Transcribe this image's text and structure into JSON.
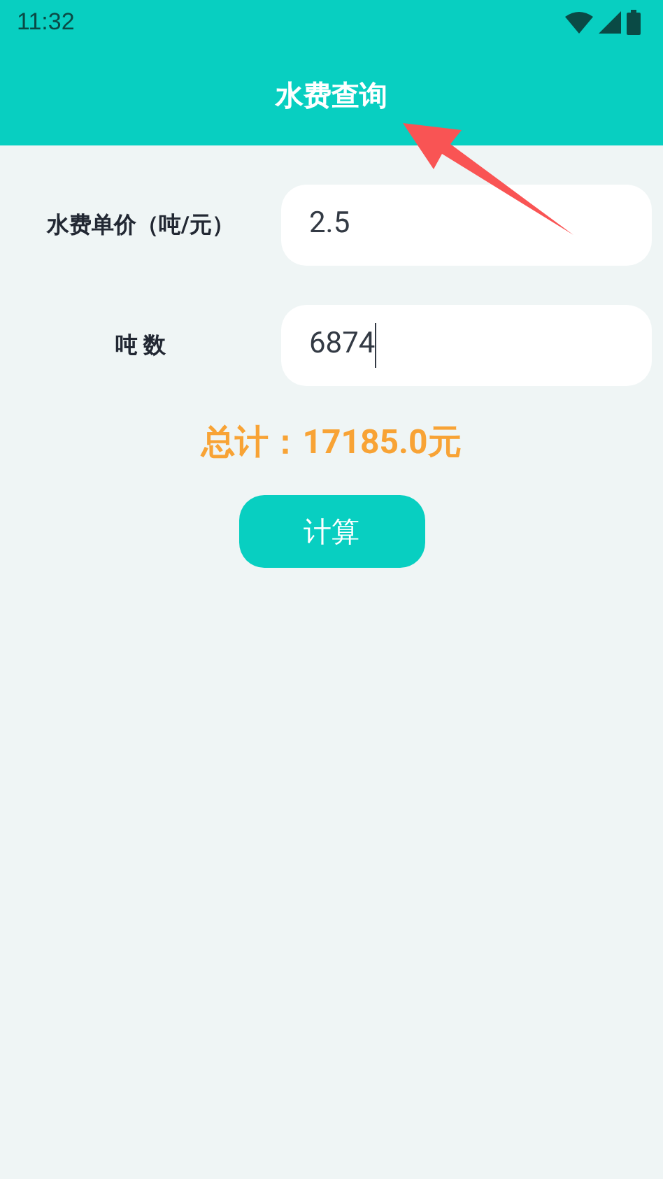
{
  "status_bar": {
    "time": "11:32"
  },
  "header": {
    "title": "水费查询"
  },
  "fields": [
    {
      "label": "水费单价（吨/元）",
      "value": "2.5",
      "focused": false
    },
    {
      "label": "吨 数",
      "value": "6874",
      "focused": true
    }
  ],
  "total": "总计：17185.0元",
  "button": "计算",
  "annotation": {
    "kind": "arrow"
  }
}
